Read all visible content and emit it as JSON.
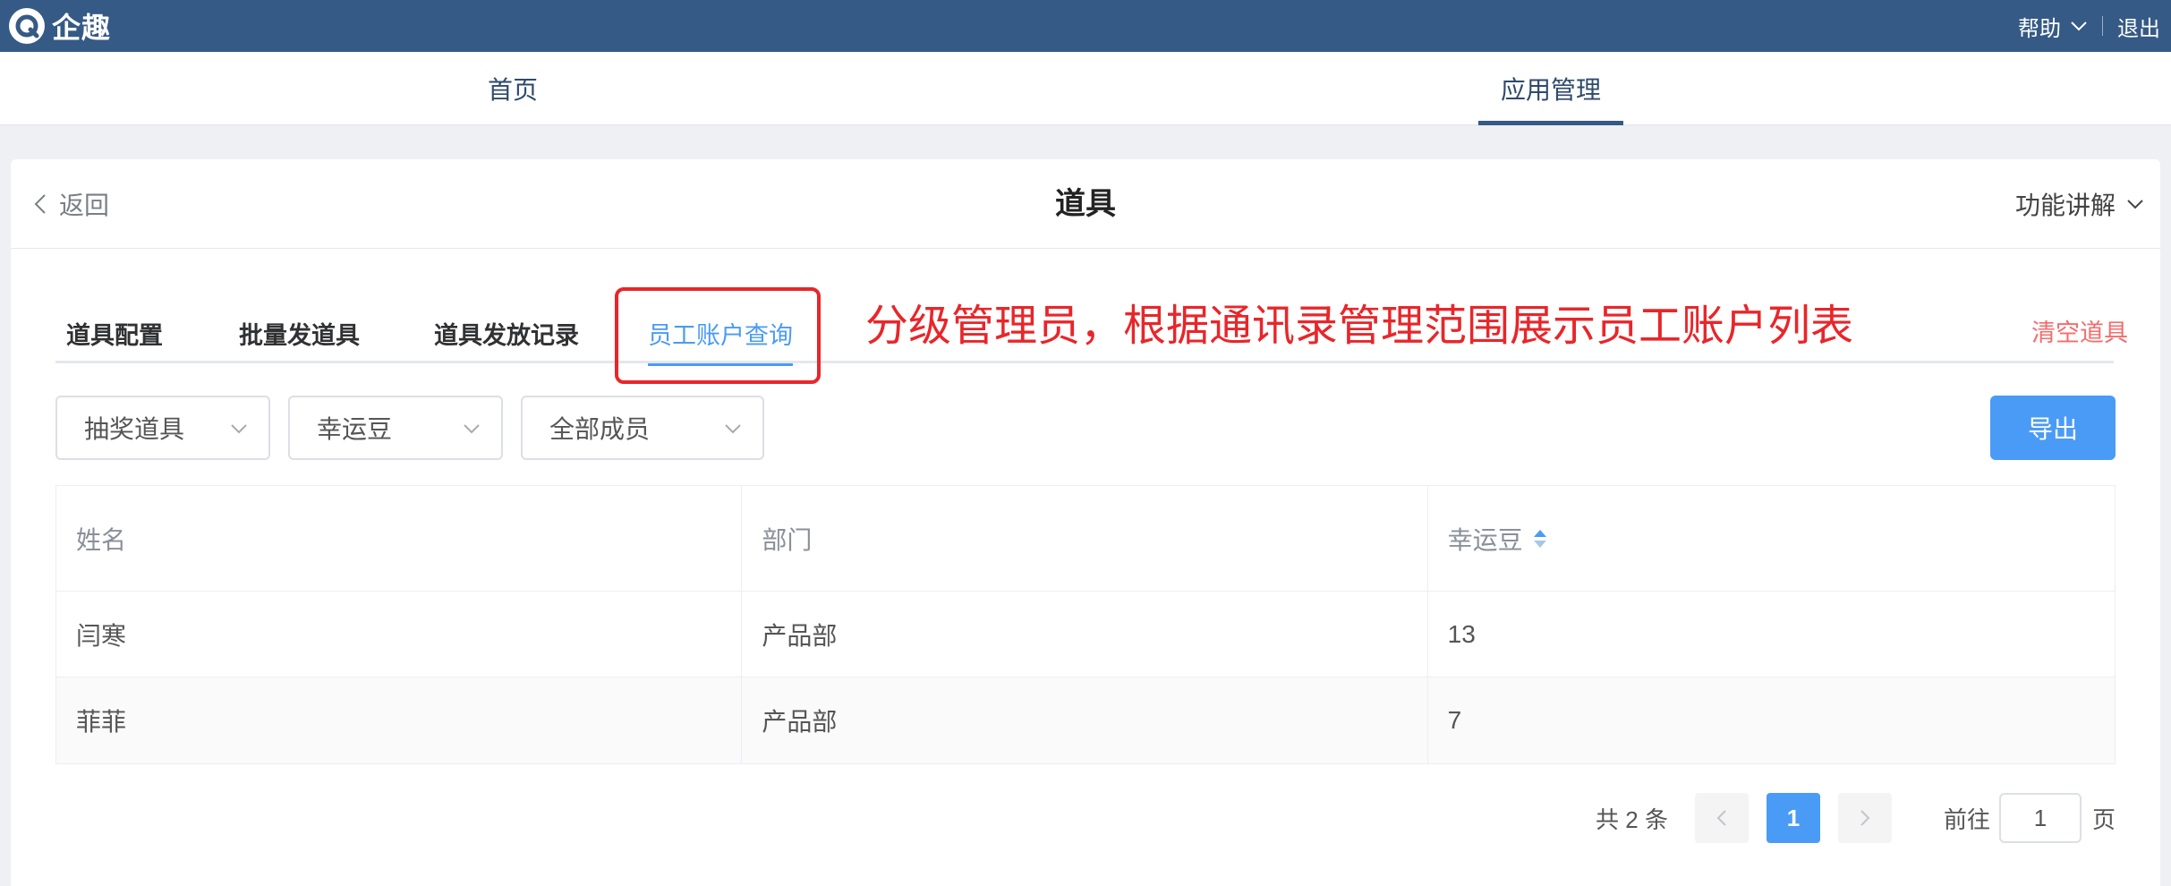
{
  "topbar": {
    "brand": "企趣",
    "help": "帮助",
    "logout": "退出"
  },
  "nav": {
    "home": "首页",
    "app_manage": "应用管理"
  },
  "header": {
    "back": "返回",
    "title": "道具",
    "feature_help": "功能讲解"
  },
  "tabs": [
    {
      "label": "道具配置",
      "active": false
    },
    {
      "label": "批量发道具",
      "active": false
    },
    {
      "label": "道具发放记录",
      "active": false
    },
    {
      "label": "员工账户查询",
      "active": true
    }
  ],
  "annotation": "分级管理员，根据通讯录管理范围展示员工账户列表",
  "clear_props": "清空道具",
  "filters": {
    "prop_type": "抽奖道具",
    "currency": "幸运豆",
    "members": "全部成员"
  },
  "export": "导出",
  "table": {
    "columns": [
      "姓名",
      "部门",
      "幸运豆"
    ],
    "rows": [
      [
        "闫寒",
        "产品部",
        "13"
      ],
      [
        "菲菲",
        "产品部",
        "7"
      ]
    ]
  },
  "pagination": {
    "total": "共 2 条",
    "current_page": "1",
    "goto_label": "前往",
    "goto_value": "1",
    "page_suffix": "页"
  },
  "colors": {
    "topbar": "#355a85",
    "accent": "#4a9bf5",
    "annotation": "#e8262a",
    "danger": "#f56c6c"
  }
}
